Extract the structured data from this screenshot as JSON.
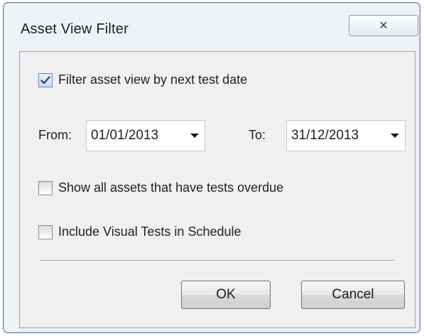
{
  "window": {
    "title": "Asset View Filter",
    "close_glyph": "✕"
  },
  "filter_checkbox": {
    "label": "Filter asset view by next test date",
    "checked": true
  },
  "date_range": {
    "from_label": "From:",
    "from_value": "01/01/2013",
    "to_label": "To:",
    "to_value": "31/12/2013"
  },
  "overdue_checkbox": {
    "label": "Show all assets that have tests overdue",
    "checked": false
  },
  "visual_tests_checkbox": {
    "label": "Include Visual Tests in Schedule",
    "checked": false
  },
  "buttons": {
    "ok": "OK",
    "cancel": "Cancel"
  },
  "icons": {
    "close": "close-icon",
    "checkmark": "checkmark-icon",
    "dropdown": "chevron-down-icon"
  }
}
